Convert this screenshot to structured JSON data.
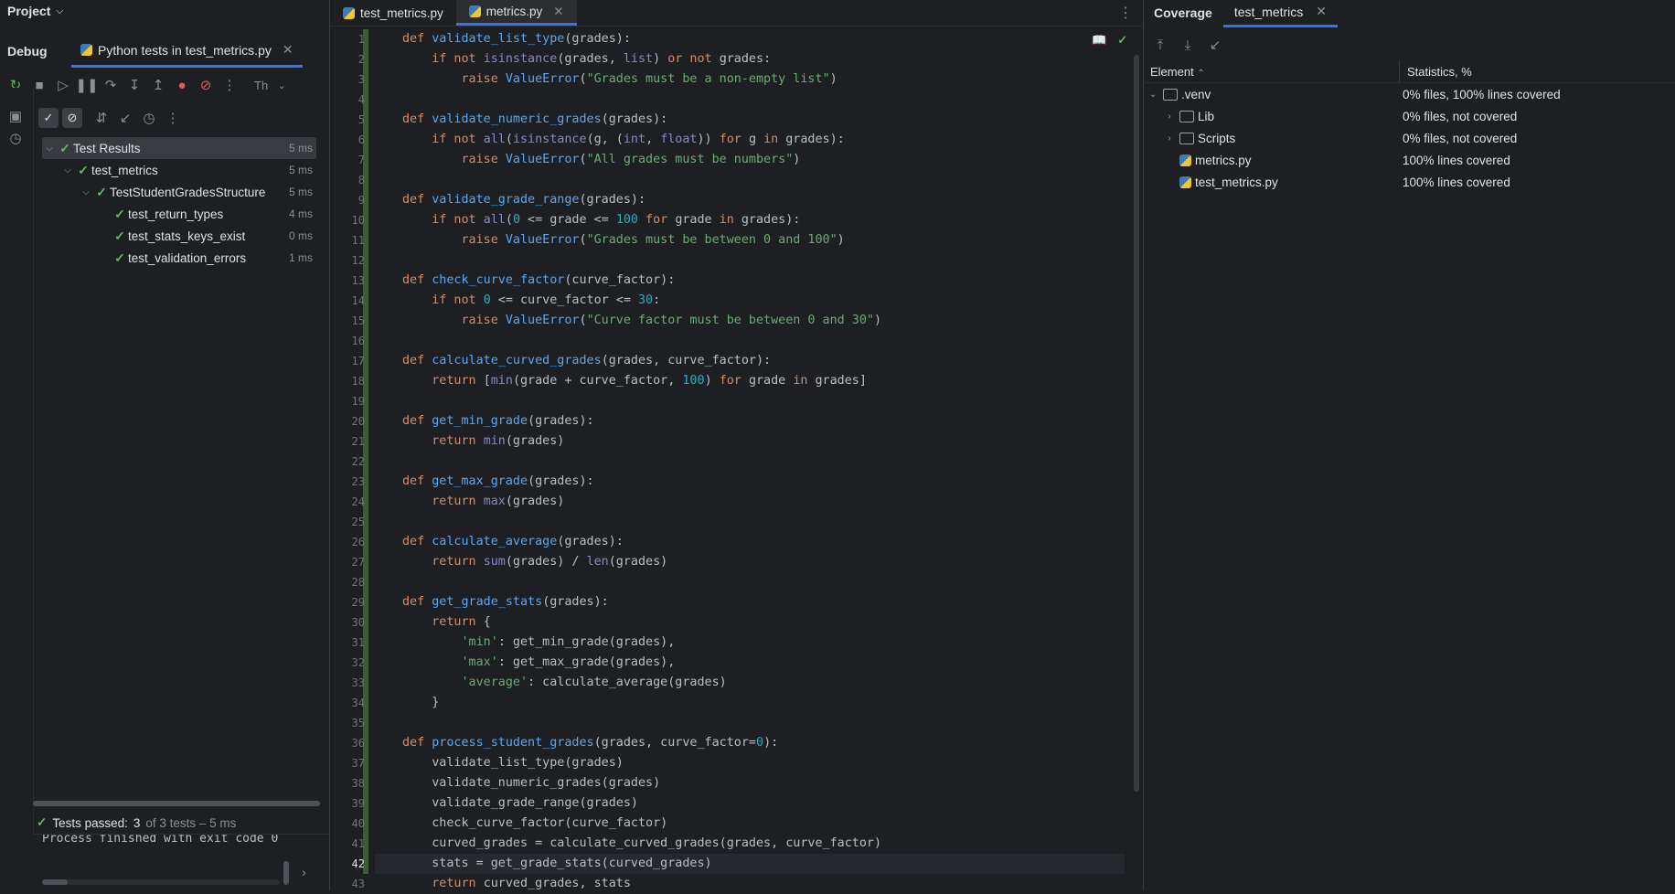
{
  "project": {
    "title": "Project"
  },
  "debug": {
    "label": "Debug",
    "tab_label": "Python tests in test_metrics.py",
    "thread_label": "Th"
  },
  "tests": {
    "rows": [
      {
        "name": "Test Results",
        "time": "5 ms"
      },
      {
        "name": "test_metrics",
        "time": "5 ms"
      },
      {
        "name": "TestStudentGradesStructure",
        "time": "5 ms"
      },
      {
        "name": "test_return_types",
        "time": "4 ms"
      },
      {
        "name": "test_stats_keys_exist",
        "time": "0 ms"
      },
      {
        "name": "test_validation_errors",
        "time": "1 ms"
      }
    ],
    "status_prefix": "Tests passed:",
    "status_count": "3",
    "status_rest": "of 3 tests – 5 ms",
    "console_line": "Process finished with exit code 0"
  },
  "editor": {
    "tabs": [
      {
        "label": "test_metrics.py"
      },
      {
        "label": "metrics.py"
      }
    ],
    "current_line": 42,
    "line_numbers": [
      "1",
      "2",
      "3",
      "4",
      "5",
      "6",
      "7",
      "8",
      "9",
      "10",
      "11",
      "12",
      "13",
      "14",
      "15",
      "16",
      "17",
      "18",
      "19",
      "20",
      "21",
      "22",
      "23",
      "24",
      "25",
      "26",
      "27",
      "28",
      "29",
      "30",
      "31",
      "32",
      "33",
      "34",
      "35",
      "36",
      "37",
      "38",
      "39",
      "40",
      "41",
      "42",
      "43"
    ]
  },
  "code_lines": [
    [
      [
        "kw",
        "def "
      ],
      [
        "fn",
        "validate_list_type"
      ],
      [
        "",
        "(grades):"
      ]
    ],
    [
      [
        "",
        "    "
      ],
      [
        "kw",
        "if not "
      ],
      [
        "bi",
        "isinstance"
      ],
      [
        "",
        "(grades, "
      ],
      [
        "bi",
        "list"
      ],
      [
        "",
        ") "
      ],
      [
        "kw",
        "or not "
      ],
      [
        "",
        "grades:"
      ]
    ],
    [
      [
        "",
        "        "
      ],
      [
        "kw",
        "raise "
      ],
      [
        "cls",
        "ValueError"
      ],
      [
        "",
        "("
      ],
      [
        "str",
        "\"Grades must be a non-empty list\""
      ],
      [
        "",
        ")"
      ]
    ],
    [],
    [
      [
        "kw",
        "def "
      ],
      [
        "fn",
        "validate_numeric_grades"
      ],
      [
        "",
        "(grades):"
      ]
    ],
    [
      [
        "",
        "    "
      ],
      [
        "kw",
        "if not "
      ],
      [
        "bi",
        "all"
      ],
      [
        "",
        "("
      ],
      [
        "bi",
        "isinstance"
      ],
      [
        "",
        "(g, ("
      ],
      [
        "bi",
        "int"
      ],
      [
        "",
        ", "
      ],
      [
        "bi",
        "float"
      ],
      [
        "",
        ")) "
      ],
      [
        "kw",
        "for "
      ],
      [
        "",
        "g "
      ],
      [
        "kw",
        "in "
      ],
      [
        "",
        "grades):"
      ]
    ],
    [
      [
        "",
        "        "
      ],
      [
        "kw",
        "raise "
      ],
      [
        "cls",
        "ValueError"
      ],
      [
        "",
        "("
      ],
      [
        "str",
        "\"All grades must be numbers\""
      ],
      [
        "",
        ")"
      ]
    ],
    [],
    [
      [
        "kw",
        "def "
      ],
      [
        "fn",
        "validate_grade_range"
      ],
      [
        "",
        "(grades):"
      ]
    ],
    [
      [
        "",
        "    "
      ],
      [
        "kw",
        "if not "
      ],
      [
        "bi",
        "all"
      ],
      [
        "",
        "("
      ],
      [
        "num",
        "0"
      ],
      [
        "",
        " <= grade <= "
      ],
      [
        "num",
        "100"
      ],
      [
        "kw",
        " for "
      ],
      [
        "",
        "grade "
      ],
      [
        "kw",
        "in "
      ],
      [
        "",
        "grades):"
      ]
    ],
    [
      [
        "",
        "        "
      ],
      [
        "kw",
        "raise "
      ],
      [
        "cls",
        "ValueError"
      ],
      [
        "",
        "("
      ],
      [
        "str",
        "\"Grades must be between 0 and 100\""
      ],
      [
        "",
        ")"
      ]
    ],
    [],
    [
      [
        "kw",
        "def "
      ],
      [
        "fn",
        "check_curve_factor"
      ],
      [
        "",
        "(curve_factor):"
      ]
    ],
    [
      [
        "",
        "    "
      ],
      [
        "kw",
        "if not "
      ],
      [
        "num",
        "0"
      ],
      [
        "",
        " <= curve_factor <= "
      ],
      [
        "num",
        "30"
      ],
      [
        "",
        ":"
      ]
    ],
    [
      [
        "",
        "        "
      ],
      [
        "kw",
        "raise "
      ],
      [
        "cls",
        "ValueError"
      ],
      [
        "",
        "("
      ],
      [
        "str",
        "\"Curve factor must be between 0 and 30\""
      ],
      [
        "",
        ")"
      ]
    ],
    [],
    [
      [
        "kw",
        "def "
      ],
      [
        "fn",
        "calculate_curved_grades"
      ],
      [
        "",
        "(grades, curve_factor):"
      ]
    ],
    [
      [
        "",
        "    "
      ],
      [
        "kw",
        "return "
      ],
      [
        "",
        "["
      ],
      [
        "bi",
        "min"
      ],
      [
        "",
        "(grade + curve_factor, "
      ],
      [
        "num",
        "100"
      ],
      [
        "",
        ") "
      ],
      [
        "kw",
        "for "
      ],
      [
        "",
        "grade "
      ],
      [
        "kw",
        "in "
      ],
      [
        "",
        "grades]"
      ]
    ],
    [],
    [
      [
        "kw",
        "def "
      ],
      [
        "fn",
        "get_min_grade"
      ],
      [
        "",
        "(grades):"
      ]
    ],
    [
      [
        "",
        "    "
      ],
      [
        "kw",
        "return "
      ],
      [
        "bi",
        "min"
      ],
      [
        "",
        "(grades)"
      ]
    ],
    [],
    [
      [
        "kw",
        "def "
      ],
      [
        "fn",
        "get_max_grade"
      ],
      [
        "",
        "(grades):"
      ]
    ],
    [
      [
        "",
        "    "
      ],
      [
        "kw",
        "return "
      ],
      [
        "bi",
        "max"
      ],
      [
        "",
        "(grades)"
      ]
    ],
    [],
    [
      [
        "kw",
        "def "
      ],
      [
        "fn",
        "calculate_average"
      ],
      [
        "",
        "(grades):"
      ]
    ],
    [
      [
        "",
        "    "
      ],
      [
        "kw",
        "return "
      ],
      [
        "bi",
        "sum"
      ],
      [
        "",
        "(grades) / "
      ],
      [
        "bi",
        "len"
      ],
      [
        "",
        "(grades)"
      ]
    ],
    [],
    [
      [
        "kw",
        "def "
      ],
      [
        "fn",
        "get_grade_stats"
      ],
      [
        "",
        "(grades):"
      ]
    ],
    [
      [
        "",
        "    "
      ],
      [
        "kw",
        "return "
      ],
      [
        "",
        "{"
      ]
    ],
    [
      [
        "",
        "        "
      ],
      [
        "str",
        "'min'"
      ],
      [
        "",
        ": get_min_grade(grades),"
      ]
    ],
    [
      [
        "",
        "        "
      ],
      [
        "str",
        "'max'"
      ],
      [
        "",
        ": get_max_grade(grades),"
      ]
    ],
    [
      [
        "",
        "        "
      ],
      [
        "str",
        "'average'"
      ],
      [
        "",
        ": calculate_average(grades)"
      ]
    ],
    [
      [
        "",
        "    }"
      ]
    ],
    [],
    [
      [
        "kw",
        "def "
      ],
      [
        "fn",
        "process_student_grades"
      ],
      [
        "",
        "(grades, curve_factor="
      ],
      [
        "num",
        "0"
      ],
      [
        "",
        "):"
      ]
    ],
    [
      [
        "",
        "    validate_list_type(grades)"
      ]
    ],
    [
      [
        "",
        "    validate_numeric_grades(grades)"
      ]
    ],
    [
      [
        "",
        "    validate_grade_range(grades)"
      ]
    ],
    [
      [
        "",
        "    check_curve_factor(curve_factor)"
      ]
    ],
    [
      [
        "",
        "    curved_grades = calculate_curved_grades(grades, curve_factor)"
      ]
    ],
    [
      [
        "",
        "    stats = get_grade_stats(curved_grades)"
      ]
    ],
    [
      [
        "",
        "    "
      ],
      [
        "kw",
        "return "
      ],
      [
        "",
        "curved_grades, stats"
      ]
    ]
  ],
  "coverage": {
    "tab_label": "Coverage",
    "run_tab": "test_metrics",
    "col_element": "Element",
    "col_stats": "Statistics, %",
    "rows": [
      {
        "name": ".venv",
        "stat": "0% files, 100% lines covered",
        "kind": "folder",
        "expanded": true,
        "level": 0
      },
      {
        "name": "Lib",
        "stat": "0% files, not covered",
        "kind": "folder",
        "expanded": false,
        "level": 1
      },
      {
        "name": "Scripts",
        "stat": "0% files, not covered",
        "kind": "folder",
        "expanded": false,
        "level": 1
      },
      {
        "name": "metrics.py",
        "stat": "100% lines covered",
        "kind": "python-file",
        "level": 1
      },
      {
        "name": "test_metrics.py",
        "stat": "100% lines covered",
        "kind": "python-file",
        "level": 1
      }
    ]
  },
  "colors": {
    "keyword": "#cf8e6d",
    "function": "#56a8f5",
    "string": "#6aab73",
    "number": "#2aacb8",
    "pass": "#5fb865",
    "accent": "#3574f0"
  }
}
